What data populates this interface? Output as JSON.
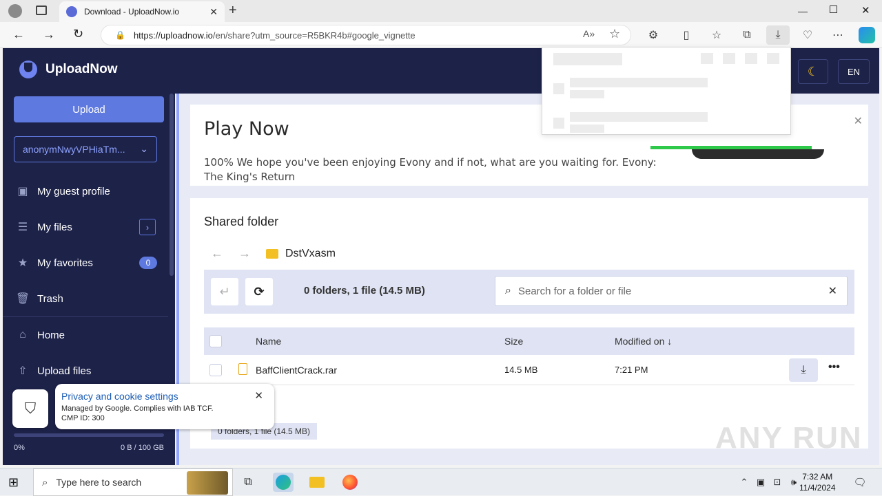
{
  "browser": {
    "tab_title": "Download - UploadNow.io",
    "url_host": "https://uploadnow.io",
    "url_path": "/en/share?utm_source=R5BKR4b#google_vignette"
  },
  "header": {
    "brand": "UploadNow",
    "lang_label": "EN"
  },
  "sidebar": {
    "upload_label": "Upload",
    "account_name": "anonymNwyVPHiaTm...",
    "items": [
      {
        "label": "My guest profile",
        "icon": "profile-icon"
      },
      {
        "label": "My files",
        "icon": "files-tree-icon"
      },
      {
        "label": "My favorites",
        "icon": "star-icon",
        "badge": "0"
      },
      {
        "label": "Trash",
        "icon": "trash-icon"
      },
      {
        "label": "Home",
        "icon": "home-icon"
      },
      {
        "label": "Upload files",
        "icon": "upload-icon"
      }
    ],
    "storage_percent": "0%",
    "storage_amount": "0 B / 100 GB",
    "storage_fraction": 0
  },
  "ad": {
    "title": "Play Now",
    "body": "100% We hope you've been enjoying Evony and if not, what are you waiting for. Evony: The King's Return"
  },
  "files": {
    "section_title": "Shared folder",
    "folder_name": "DstVxasm",
    "summary": "0 folders, 1 file (14.5 MB)",
    "search_placeholder": "Search for a folder or file",
    "columns": {
      "name": "Name",
      "size": "Size",
      "modified": "Modified on ↓"
    },
    "rows": [
      {
        "name": "BaffClientCrack.rar",
        "size": "14.5 MB",
        "modified": "7:21 PM"
      }
    ],
    "footer_summary": "0 folders, 1 file (14.5 MB)"
  },
  "cookie": {
    "title": "Privacy and cookie settings",
    "line1": "Managed by Google. Complies with IAB TCF.",
    "line2": "CMP ID: 300"
  },
  "watermark": "ANY RUN",
  "taskbar": {
    "search_placeholder": "Type here to search",
    "time": "7:32 AM",
    "date": "11/4/2024"
  },
  "colors": {
    "sidebar_bg": "#1d2249",
    "accent": "#5e79e0",
    "progress_green": "#2ec84a"
  }
}
